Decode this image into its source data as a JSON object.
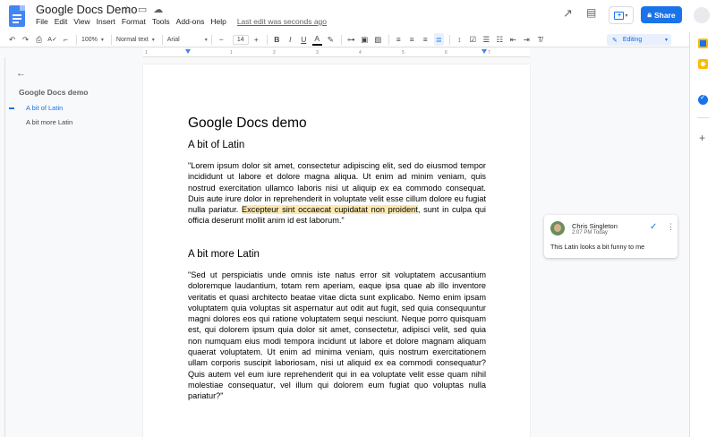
{
  "app": {
    "title": "Google Docs Demo",
    "last_edit": "Last edit was seconds ago",
    "share_label": "Share",
    "icons": [
      "star-icon",
      "folder-icon",
      "cloud-icon",
      "trending-icon",
      "comment-icon",
      "present-icon"
    ]
  },
  "menu": [
    "File",
    "Edit",
    "View",
    "Insert",
    "Format",
    "Tools",
    "Add-ons",
    "Help"
  ],
  "toolbar": {
    "zoom": "100%",
    "style": "Normal text",
    "font": "Arial",
    "font_size": "14",
    "mode": "Editing"
  },
  "outline": {
    "title": "Google Docs demo",
    "items": [
      "A bit of Latin",
      "A bit more Latin"
    ]
  },
  "document": {
    "title": "Google Docs demo",
    "h2_1": "A bit of Latin",
    "p1_before": "\"Lorem ipsum dolor sit amet, consectetur adipiscing elit, sed do eiusmod tempor incididunt ut labore et dolore magna aliqua. Ut enim ad minim veniam, quis nostrud exercitation ullamco laboris nisi ut aliquip ex ea commodo consequat. Duis aute irure dolor in reprehenderit in voluptate velit esse cillum dolore eu fugiat nulla pariatur. ",
    "p1_highlight": "Excepteur sint occaecat cupidatat non proident",
    "p1_after": ", sunt in culpa qui officia deserunt mollit anim id est laborum.\"",
    "h2_2": "A bit more Latin",
    "p2": "\"Sed ut perspiciatis unde omnis iste natus error sit voluptatem accusantium doloremque laudantium, totam rem aperiam, eaque ipsa quae ab illo inventore veritatis et quasi architecto beatae vitae dicta sunt explicabo. Nemo enim ipsam voluptatem quia voluptas sit aspernatur aut odit aut fugit, sed quia consequuntur magni dolores eos qui ratione voluptatem sequi nesciunt. Neque porro quisquam est, qui dolorem ipsum quia dolor sit amet, consectetur, adipisci velit, sed quia non numquam eius modi tempora incidunt ut labore et dolore magnam aliquam quaerat voluptatem. Ut enim ad minima veniam, quis nostrum exercitationem ullam corporis suscipit laboriosam, nisi ut aliquid ex ea commodi consequatur? Quis autem vel eum iure reprehenderit qui in ea voluptate velit esse quam nihil molestiae consequatur, vel illum qui dolorem eum fugiat quo voluptas nulla pariatur?\""
  },
  "comment": {
    "author": "Chris Singleton",
    "time": "2:07 PM Today",
    "text": "This Latin looks a bit funny to me"
  },
  "ruler_ticks": [
    "1",
    "1",
    "2",
    "3",
    "4",
    "5",
    "6",
    "7"
  ],
  "colors": {
    "accent": "#1a73e8",
    "highlight": "#fce8b2"
  }
}
